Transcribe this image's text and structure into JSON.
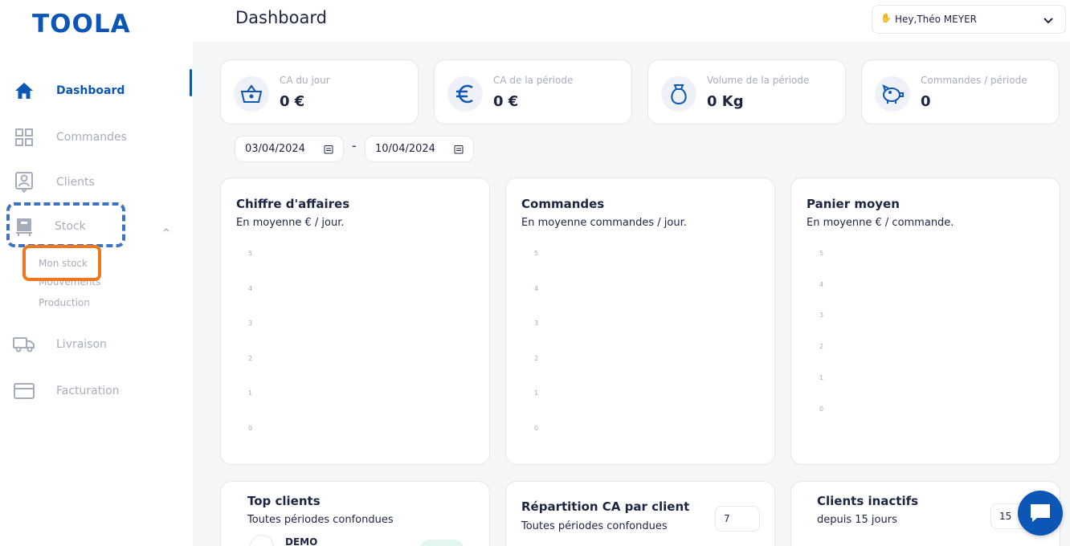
{
  "app": {
    "logo": "TOOLA"
  },
  "sidebar": {
    "items": [
      {
        "label": "Dashboard",
        "icon": "home-icon"
      },
      {
        "label": "Commandes",
        "icon": "grid-icon"
      },
      {
        "label": "Clients",
        "icon": "contact-card-icon"
      },
      {
        "label": "Stock",
        "icon": "warehouse-icon"
      },
      {
        "label": "Livraison",
        "icon": "truck-icon"
      },
      {
        "label": "Facturation",
        "icon": "credit-card-icon"
      }
    ],
    "stock_sub": [
      "Mon stock",
      "Mouvements",
      "Production"
    ]
  },
  "header": {
    "title": "Dashboard",
    "user_greeting": "Hey,Théo MEYER",
    "user_greeting_icon": "waving-hand-icon"
  },
  "kpis": [
    {
      "label": "CA du jour",
      "value": "0 €",
      "icon": "basket-icon"
    },
    {
      "label": "CA de la période",
      "value": "0 €",
      "icon": "euro-icon"
    },
    {
      "label": "Volume de la période",
      "value": "0 Kg",
      "icon": "weight-icon"
    },
    {
      "label": "Commandes / période",
      "value": "0",
      "icon": "piggy-bank-icon"
    }
  ],
  "date_range": {
    "start": "03/04/2024",
    "end": "10/04/2024",
    "separator": "-"
  },
  "charts": [
    {
      "title": "Chiffre d'affaires",
      "subtitle": "En moyenne € / jour.",
      "yticks": [
        "5",
        "4",
        "3",
        "2",
        "1",
        "0"
      ]
    },
    {
      "title": "Commandes",
      "subtitle": "En moyenne commandes / jour.",
      "yticks": [
        "5",
        "4",
        "3",
        "2",
        "1",
        "0"
      ]
    },
    {
      "title": "Panier moyen",
      "subtitle": "En moyenne € / commande.",
      "yticks": [
        "5",
        "4",
        "3",
        "2",
        "1",
        "0"
      ]
    }
  ],
  "chart_data": [
    {
      "type": "bar",
      "title": "Chiffre d'affaires",
      "ylim": [
        0,
        5
      ],
      "values": []
    },
    {
      "type": "bar",
      "title": "Commandes",
      "ylim": [
        0,
        5
      ],
      "values": []
    },
    {
      "type": "bar",
      "title": "Panier moyen",
      "ylim": [
        0,
        5
      ],
      "values": []
    }
  ],
  "bottom": {
    "top_clients": {
      "title": "Top clients",
      "subtitle": "Toutes périodes confondues",
      "first_client": "DEMO"
    },
    "repartition": {
      "title": "Répartition CA par client",
      "subtitle": "Toutes périodes confondues",
      "input_value": "7"
    },
    "inactifs": {
      "title": "Clients inactifs",
      "subtitle": "depuis 15 jours",
      "input_value": "15"
    }
  },
  "colors": {
    "brand": "#0c56b5",
    "highlight_orange": "#f0771c",
    "highlight_dashed": "#3f72c4"
  }
}
